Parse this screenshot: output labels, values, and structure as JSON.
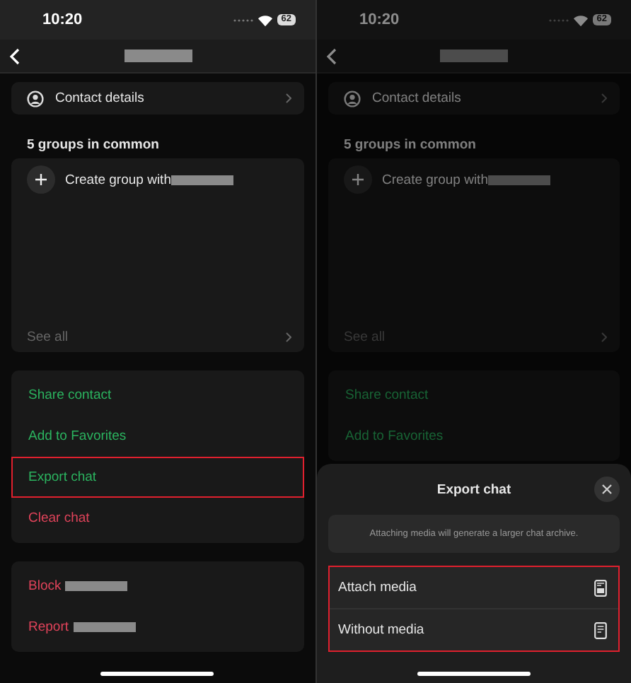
{
  "screens": [
    {
      "status_bar": {
        "time": "10:20",
        "battery": "62"
      },
      "header": {
        "redacted": true
      },
      "contact_details": "Contact details",
      "groups_heading": "5 groups in common",
      "create_group": {
        "label": "Create group with",
        "redacted": true
      },
      "see_all": "See all",
      "actions": [
        {
          "label": "Share contact",
          "kind": "positive",
          "highlighted": false
        },
        {
          "label": "Add to Favorites",
          "kind": "positive",
          "highlighted": false
        },
        {
          "label": "Export chat",
          "kind": "positive",
          "highlighted": true
        },
        {
          "label": "Clear chat",
          "kind": "destructive",
          "highlighted": false
        }
      ],
      "danger": [
        {
          "label": "Block",
          "redacted": true
        },
        {
          "label": "Report",
          "redacted": true
        }
      ]
    },
    {
      "status_bar": {
        "time": "10:20",
        "battery": "62"
      },
      "header": {
        "redacted": true
      },
      "contact_details": "Contact details",
      "groups_heading": "5 groups in common",
      "create_group": {
        "label": "Create group with",
        "redacted": true
      },
      "see_all": "See all",
      "actions": [
        {
          "label": "Share contact",
          "kind": "positive",
          "highlighted": false
        },
        {
          "label": "Add to Favorites",
          "kind": "positive",
          "highlighted": false
        }
      ],
      "sheet": {
        "title": "Export chat",
        "note": "Attaching media will generate a larger chat archive.",
        "highlighted": true,
        "options": [
          {
            "label": "Attach media",
            "kind": "media"
          },
          {
            "label": "Without media",
            "kind": "document"
          }
        ]
      }
    }
  ]
}
